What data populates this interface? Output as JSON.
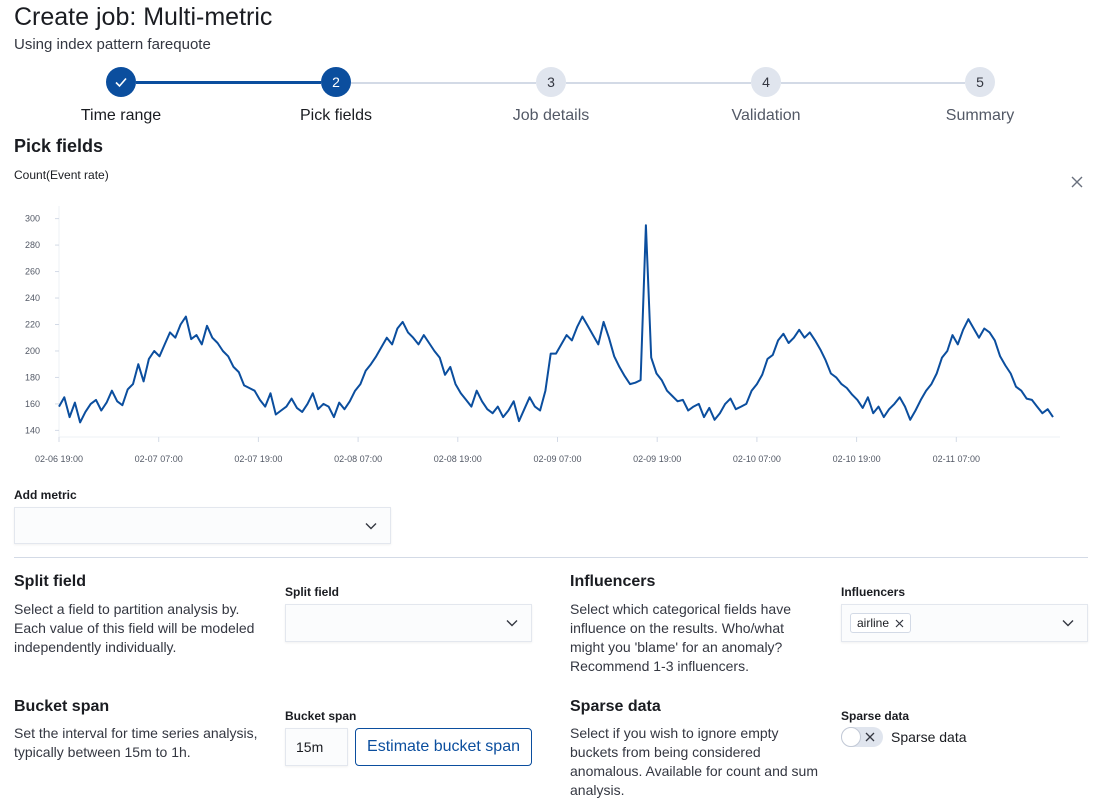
{
  "header": {
    "title": "Create job: Multi-metric",
    "subtitle": "Using index pattern farequote"
  },
  "steps": [
    {
      "number": "1",
      "label": "Time range",
      "state": "complete"
    },
    {
      "number": "2",
      "label": "Pick fields",
      "state": "current"
    },
    {
      "number": "3",
      "label": "Job details",
      "state": "incomplete"
    },
    {
      "number": "4",
      "label": "Validation",
      "state": "incomplete"
    },
    {
      "number": "5",
      "label": "Summary",
      "state": "incomplete"
    }
  ],
  "section_title": "Pick fields",
  "metric_chart": {
    "title": "Count(Event rate)",
    "close_icon": "close-icon"
  },
  "chart_data": {
    "type": "line",
    "title": "Count(Event rate)",
    "xlabel": "",
    "ylabel": "",
    "ylim": [
      135,
      305
    ],
    "y_ticks": [
      "140",
      "160",
      "180",
      "200",
      "220",
      "240",
      "260",
      "280",
      "300"
    ],
    "x_ticks": [
      "02-06 19:00",
      "02-07 07:00",
      "02-07 19:00",
      "02-08 07:00",
      "02-08 19:00",
      "02-09 07:00",
      "02-09 19:00",
      "02-10 07:00",
      "02-10 19:00",
      "02-11 07:00"
    ],
    "x_range": [
      "2017-02-06 19:00",
      "2017-02-11 18:30"
    ],
    "series": [
      {
        "values": [
          158,
          165,
          150,
          161,
          146,
          154,
          160,
          163,
          155,
          161,
          170,
          162,
          159,
          171,
          175,
          190,
          177,
          194,
          200,
          196,
          205,
          214,
          210,
          220,
          226,
          209,
          212,
          205,
          219,
          210,
          206,
          200,
          196,
          188,
          184,
          174,
          172,
          170,
          163,
          158,
          168,
          152,
          155,
          158,
          164,
          157,
          154,
          160,
          168,
          156,
          160,
          158,
          150,
          161,
          156,
          162,
          170,
          175,
          185,
          190,
          196,
          203,
          210,
          205,
          217,
          222,
          214,
          210,
          205,
          212,
          206,
          200,
          195,
          182,
          188,
          175,
          168,
          163,
          158,
          170,
          162,
          156,
          153,
          158,
          150,
          155,
          162,
          147,
          156,
          165,
          158,
          155,
          170,
          198,
          198,
          205,
          212,
          208,
          218,
          226,
          219,
          212,
          205,
          222,
          210,
          196,
          188,
          181,
          175,
          176,
          178,
          295,
          195,
          183,
          178,
          170,
          166,
          162,
          163,
          155,
          158,
          160,
          150,
          157,
          148,
          153,
          160,
          164,
          156,
          158,
          160,
          170,
          175,
          182,
          194,
          197,
          208,
          213,
          206,
          210,
          216,
          210,
          214,
          208,
          201,
          193,
          183,
          180,
          175,
          172,
          167,
          163,
          157,
          165,
          153,
          158,
          150,
          156,
          160,
          165,
          158,
          148,
          155,
          163,
          170,
          175,
          183,
          195,
          200,
          212,
          205,
          216,
          224,
          217,
          210,
          217,
          214,
          208,
          196,
          189,
          183,
          173,
          170,
          164,
          163,
          158,
          153,
          156,
          150
        ]
      }
    ]
  },
  "add_metric": {
    "label": "Add metric",
    "value": ""
  },
  "split_field": {
    "heading": "Split field",
    "description": "Select a field to partition analysis by. Each value of this field will be modeled independently individually.",
    "label": "Split field",
    "value": ""
  },
  "influencers": {
    "heading": "Influencers",
    "description": "Select which categorical fields have influence on the results. Who/what might you 'blame' for an anomaly? Recommend 1-3 influencers.",
    "label": "Influencers",
    "selected": [
      "airline"
    ]
  },
  "bucket_span": {
    "heading": "Bucket span",
    "description": "Set the interval for time series analysis, typically between 15m to 1h.",
    "label": "Bucket span",
    "value": "15m",
    "estimate_button": "Estimate bucket span"
  },
  "sparse_data": {
    "heading": "Sparse data",
    "description": "Select if you wish to ignore empty buckets from being considered anomalous. Available for count and sum analysis.",
    "label": "Sparse data",
    "switch_label": "Sparse data",
    "enabled": false
  },
  "colors": {
    "primary": "#0b4e9e",
    "line": "#0b4e9e",
    "step_incomplete": "#e0e5ee"
  }
}
